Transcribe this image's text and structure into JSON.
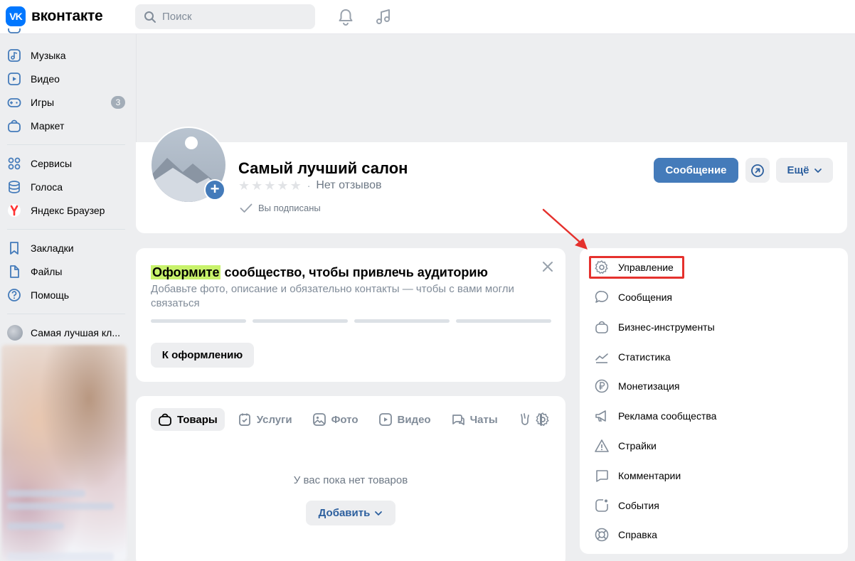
{
  "header": {
    "logo_mark": "VK",
    "logo_text": "вконтакте",
    "search_placeholder": "Поиск"
  },
  "sidebar": {
    "items": [
      {
        "label": "Музыка",
        "icon": "music-icon"
      },
      {
        "label": "Видео",
        "icon": "video-icon"
      },
      {
        "label": "Игры",
        "icon": "gamepad-icon",
        "badge": "3"
      },
      {
        "label": "Маркет",
        "icon": "market-bag-icon"
      },
      {
        "label": "Сервисы",
        "icon": "services-icon"
      },
      {
        "label": "Голоса",
        "icon": "coins-icon"
      },
      {
        "label": "Яндекс Браузер",
        "icon": "yandex-icon"
      },
      {
        "label": "Закладки",
        "icon": "bookmark-icon"
      },
      {
        "label": "Файлы",
        "icon": "file-icon"
      },
      {
        "label": "Помощь",
        "icon": "help-icon"
      },
      {
        "label": "Самая лучшая кл...",
        "icon": "group-avatar"
      }
    ]
  },
  "profile": {
    "name": "Самый лучший салон",
    "rating_stars": 0,
    "no_reviews": "Нет отзывов",
    "rating_sep": "·",
    "subscribed": "Вы подписаны",
    "message_button": "Сообщение",
    "more_button": "Ещё"
  },
  "onboarding": {
    "title_highlight": "Оформите",
    "title_rest": "сообщество, чтобы привлечь аудиторию",
    "description": "Добавьте фото, описание и обязательно контакты — чтобы с вами могли связаться",
    "progress_steps": 4,
    "button": "К оформлению"
  },
  "content_tabs": {
    "tabs": [
      {
        "label": "Товары",
        "icon": "bag-icon",
        "active": true
      },
      {
        "label": "Услуги",
        "icon": "calendar-check-icon",
        "active": false
      },
      {
        "label": "Фото",
        "icon": "photo-icon",
        "active": false
      },
      {
        "label": "Видео",
        "icon": "video-icon",
        "active": false
      },
      {
        "label": "Чаты",
        "icon": "chats-icon",
        "active": false
      }
    ],
    "empty_text": "У вас пока нет товаров",
    "add_button": "Добавить"
  },
  "right_menu": {
    "items": [
      {
        "label": "Управление",
        "icon": "gear-icon"
      },
      {
        "label": "Сообщения",
        "icon": "message-icon"
      },
      {
        "label": "Бизнес-инструменты",
        "icon": "briefcase-icon"
      },
      {
        "label": "Статистика",
        "icon": "chart-icon"
      },
      {
        "label": "Монетизация",
        "icon": "ruble-icon"
      },
      {
        "label": "Реклама сообщества",
        "icon": "megaphone-icon"
      },
      {
        "label": "Страйки",
        "icon": "warning-icon"
      },
      {
        "label": "Комментарии",
        "icon": "comment-icon"
      },
      {
        "label": "События",
        "icon": "event-icon"
      },
      {
        "label": "Справка",
        "icon": "lifebuoy-icon"
      }
    ]
  },
  "colors": {
    "accent": "#447bba",
    "brand": "#0077ff",
    "highlight": "#c8f26b",
    "annotation": "#e5312d"
  }
}
